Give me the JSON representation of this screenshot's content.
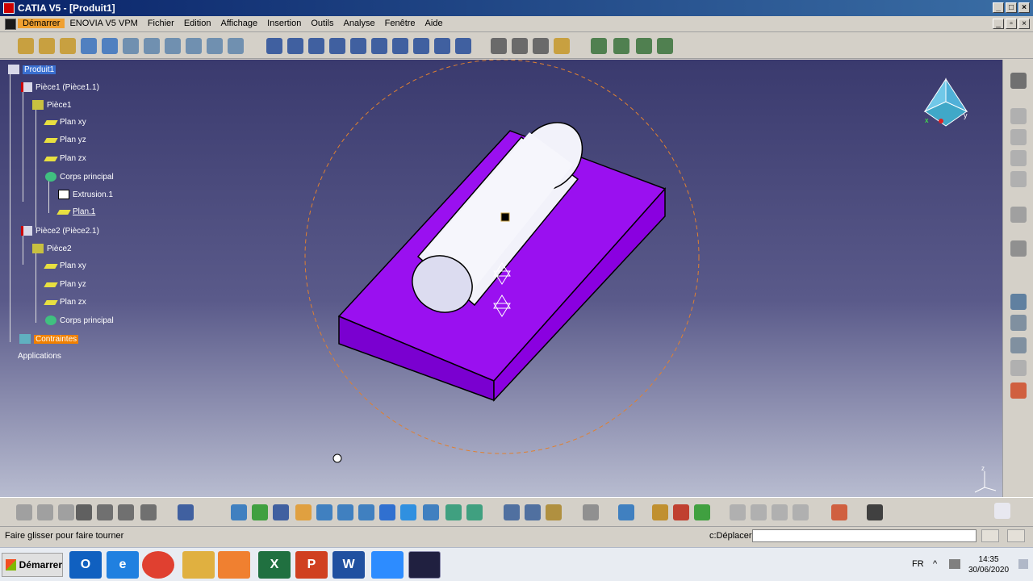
{
  "window": {
    "title": "CATIA V5 - [Produit1]"
  },
  "menu": {
    "items": [
      "Démarrer",
      "ENOVIA V5 VPM",
      "Fichier",
      "Edition",
      "Affichage",
      "Insertion",
      "Outils",
      "Analyse",
      "Fenêtre",
      "Aide"
    ],
    "active": "Démarrer"
  },
  "tree": {
    "root": "Produit1",
    "piece1_instance": "Pièce1 (Pièce1.1)",
    "piece1": "Pièce1",
    "p1_plan_xy": "Plan xy",
    "p1_plan_yz": "Plan yz",
    "p1_plan_zx": "Plan zx",
    "p1_corps": "Corps principal",
    "p1_extrusion": "Extrusion.1",
    "p1_plan1": "Plan.1",
    "piece2_instance": "Pièce2 (Pièce2.1)",
    "piece2": "Pièce2",
    "p2_plan_xy": "Plan xy",
    "p2_plan_yz": "Plan yz",
    "p2_plan_zx": "Plan zx",
    "p2_corps": "Corps principal",
    "contraintes": "Contraintes",
    "applications": "Applications"
  },
  "compass": {
    "x_label": "x",
    "y_label": "y",
    "z_label": "z"
  },
  "status": {
    "message": "Faire glisser pour faire tourner",
    "command_label": "c:Déplacer",
    "command_value": ""
  },
  "taskbar": {
    "start_label": "Démarrer",
    "apps": [
      "outlook-icon",
      "ie-icon",
      "chrome-icon",
      "explorer-icon",
      "media-icon",
      "excel-icon",
      "powerpoint-icon",
      "word-icon",
      "zoom-icon",
      "catia-icon"
    ],
    "language": "FR",
    "time": "14:35",
    "date": "30/06/2020"
  },
  "colors": {
    "model_purple": "#9a10f0",
    "cylinder": "#f2f2fa",
    "selection_orange": "#f08000",
    "title_blue": "#0a246a"
  }
}
